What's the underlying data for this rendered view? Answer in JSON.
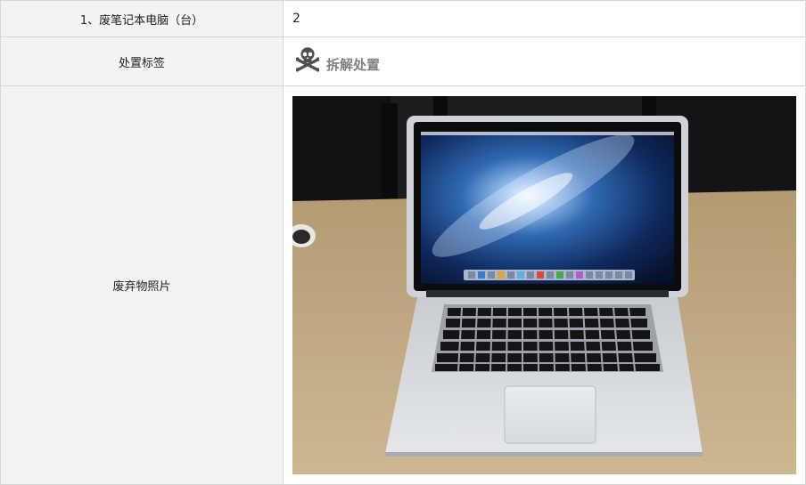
{
  "rows": [
    {
      "label": "1、废笔记本电脑（台）",
      "value": "2"
    },
    {
      "label": "处置标签",
      "tag_icon": "skull-crossbones-icon",
      "tag_text": "拆解处置",
      "tag_color": "#7f7f7f"
    },
    {
      "label": "废弃物照片",
      "photo": "laptop-photo"
    }
  ],
  "colors": {
    "label_background": "#f2f3f5",
    "border": "#d6d6d6"
  }
}
